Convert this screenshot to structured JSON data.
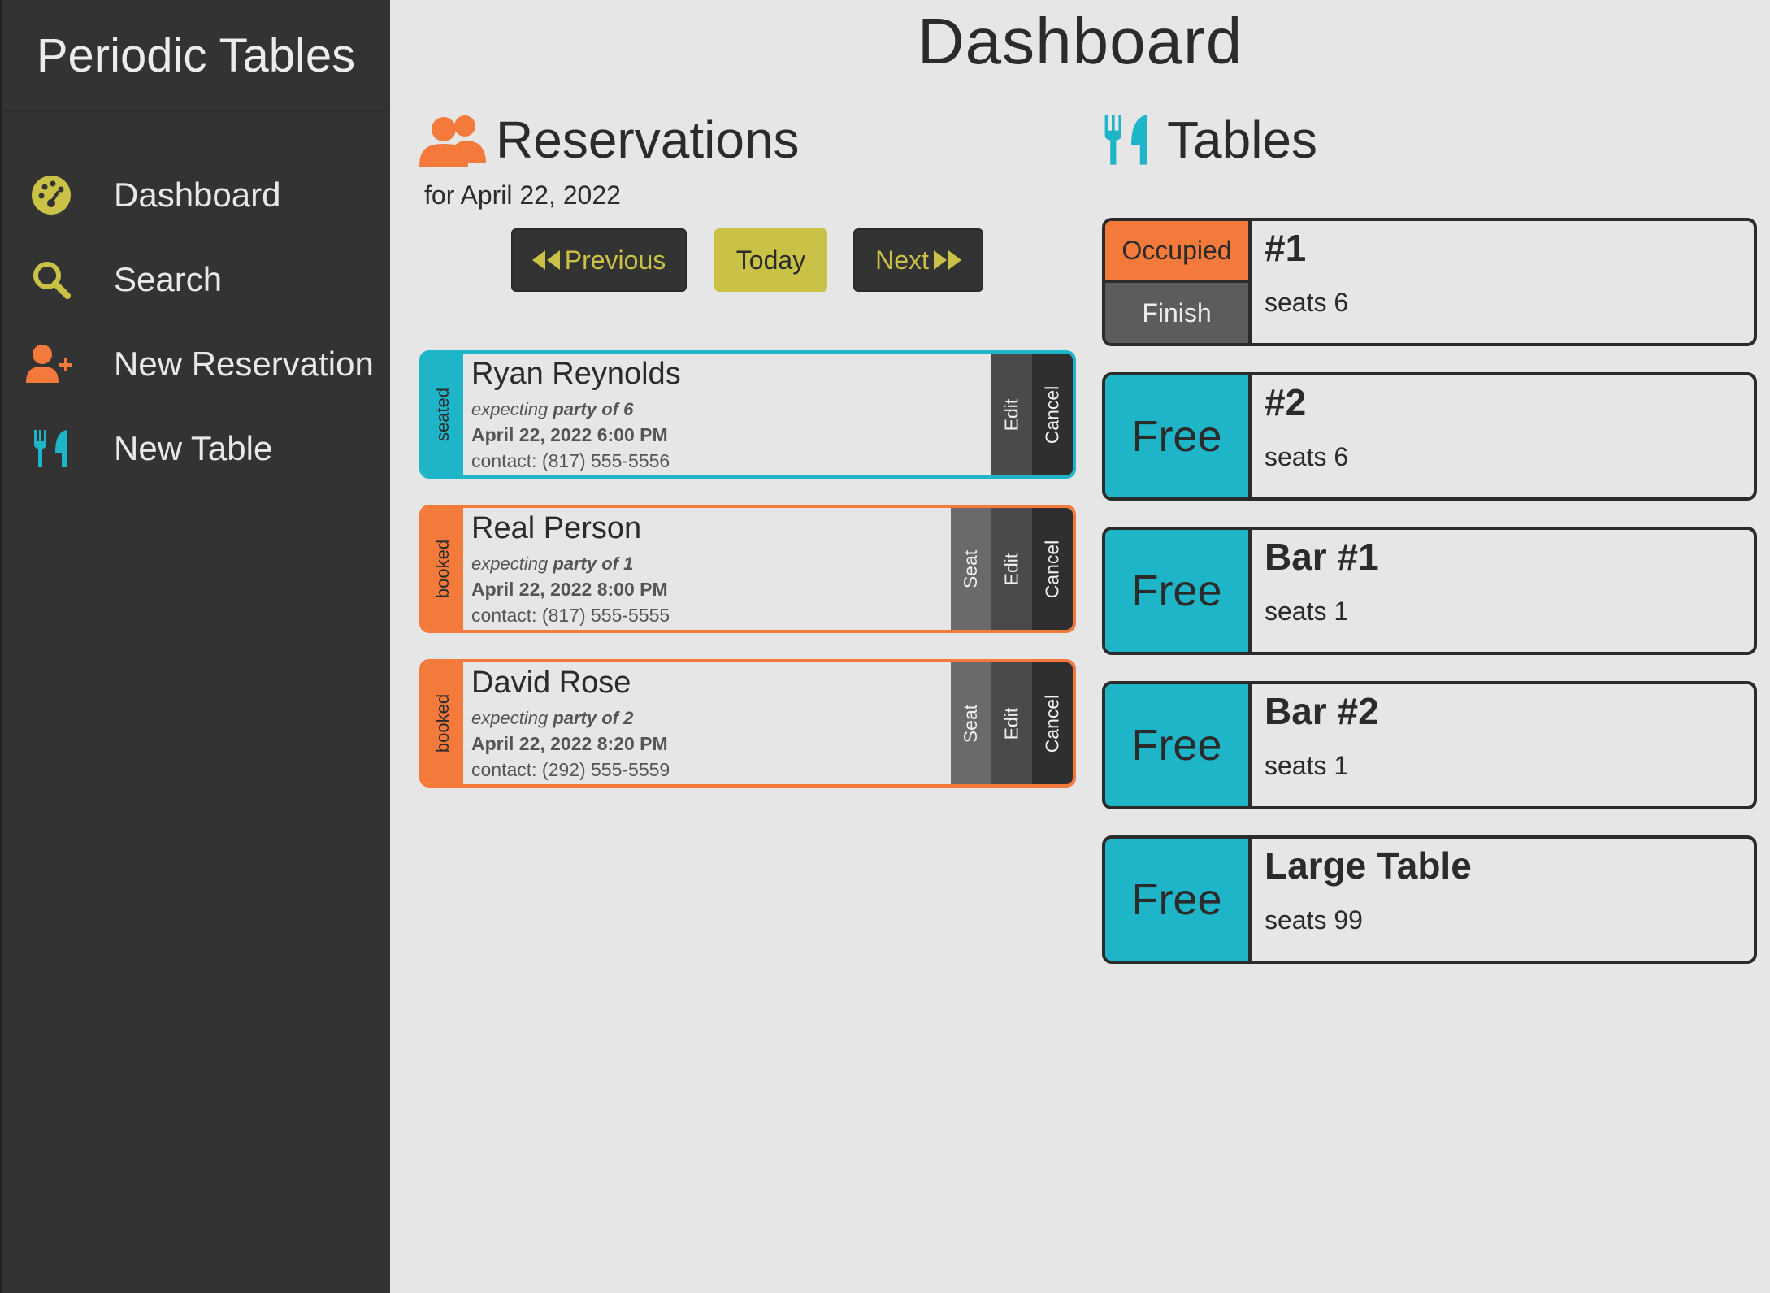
{
  "app_title": "Periodic Tables",
  "sidebar": {
    "items": [
      {
        "label": "Dashboard",
        "icon": "dashboard-icon"
      },
      {
        "label": "Search",
        "icon": "search-icon"
      },
      {
        "label": "New Reservation",
        "icon": "user-plus-icon"
      },
      {
        "label": "New Table",
        "icon": "utensils-icon"
      }
    ]
  },
  "page_title": "Dashboard",
  "reservations": {
    "title": "Reservations",
    "date_label": "for April 22, 2022",
    "nav": {
      "previous": "Previous",
      "today": "Today",
      "next": "Next"
    },
    "items": [
      {
        "status": "seated",
        "name": "Ryan Reynolds",
        "party_prefix": "expecting",
        "party": "party of 6",
        "datetime": "April 22, 2022 6:00 PM",
        "contact": "contact: (817) 555-5556",
        "actions": {
          "edit": "Edit",
          "cancel": "Cancel"
        }
      },
      {
        "status": "booked",
        "name": "Real Person",
        "party_prefix": "expecting",
        "party": "party of 1",
        "datetime": "April 22, 2022 8:00 PM",
        "contact": "contact: (817) 555-5555",
        "actions": {
          "seat": "Seat",
          "edit": "Edit",
          "cancel": "Cancel"
        }
      },
      {
        "status": "booked",
        "name": "David Rose",
        "party_prefix": "expecting",
        "party": "party of 2",
        "datetime": "April 22, 2022 8:20 PM",
        "contact": "contact: (292) 555-5559",
        "actions": {
          "seat": "Seat",
          "edit": "Edit",
          "cancel": "Cancel"
        }
      }
    ]
  },
  "tables": {
    "title": "Tables",
    "items": [
      {
        "name": "#1",
        "seats": "seats 6",
        "status": "Occupied",
        "finish": "Finish"
      },
      {
        "name": "#2",
        "seats": "seats 6",
        "status": "Free"
      },
      {
        "name": "Bar #1",
        "seats": "seats 1",
        "status": "Free"
      },
      {
        "name": "Bar #2",
        "seats": "seats 1",
        "status": "Free"
      },
      {
        "name": "Large Table",
        "seats": "seats 99",
        "status": "Free"
      }
    ]
  },
  "colors": {
    "sidebar_bg": "#333333",
    "page_bg": "#e6e6e6",
    "accent_yellow": "#c9c247",
    "accent_teal": "#1fb5c8",
    "accent_orange": "#f47a3c"
  }
}
